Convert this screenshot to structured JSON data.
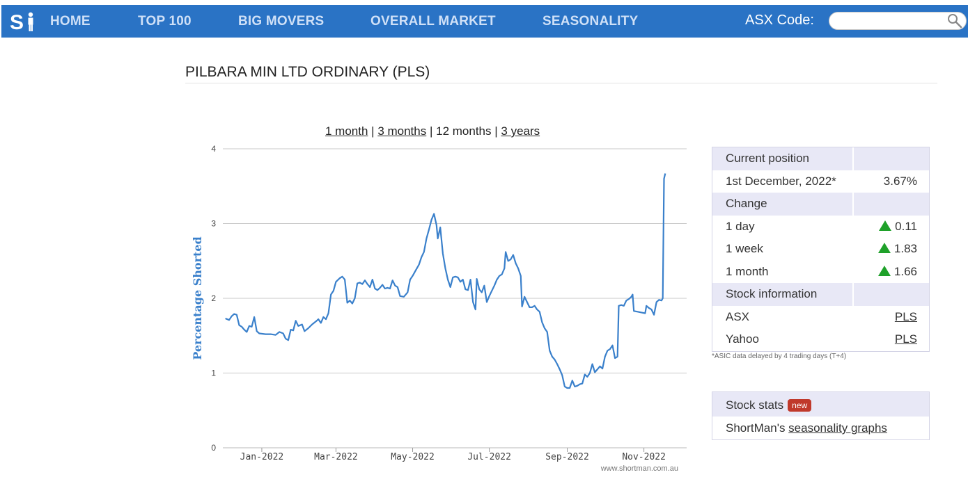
{
  "nav": {
    "items": [
      "HOME",
      "TOP 100",
      "BIG MOVERS",
      "OVERALL MARKET",
      "SEASONALITY"
    ],
    "asx_code_label": "ASX Code:",
    "search_value": ""
  },
  "page": {
    "title": "PILBARA MIN LTD ORDINARY (PLS)"
  },
  "range": {
    "links": [
      "1 month",
      "3 months",
      "12 months",
      "3 years"
    ],
    "active": "12 months"
  },
  "chart_data": {
    "type": "line",
    "ylabel": "Percentage Shorted",
    "ylim": [
      0,
      4
    ],
    "yticks": [
      "0",
      "1",
      "2",
      "3",
      "4"
    ],
    "xticks": [
      "Jan-2022",
      "Mar-2022",
      "May-2022",
      "Jul-2022",
      "Sep-2022",
      "Nov-2022"
    ],
    "xlim": [
      "2021-12-01",
      "2022-12-05"
    ],
    "grid": true,
    "watermark": "www.shortman.com.au",
    "line_color": "#3a80cb",
    "series": [
      {
        "points": [
          [
            "2021-12-03",
            1.73
          ],
          [
            "2021-12-06",
            1.71
          ],
          [
            "2021-12-08",
            1.76
          ],
          [
            "2021-12-10",
            1.79
          ],
          [
            "2021-12-12",
            1.78
          ],
          [
            "2021-12-14",
            1.64
          ],
          [
            "2021-12-16",
            1.62
          ],
          [
            "2021-12-18",
            1.58
          ],
          [
            "2021-12-20",
            1.55
          ],
          [
            "2021-12-22",
            1.63
          ],
          [
            "2021-12-24",
            1.62
          ],
          [
            "2021-12-26",
            1.75
          ],
          [
            "2021-12-28",
            1.56
          ],
          [
            "2021-12-30",
            1.53
          ],
          [
            "2022-01-04",
            1.52
          ],
          [
            "2022-01-08",
            1.52
          ],
          [
            "2022-01-12",
            1.51
          ],
          [
            "2022-01-15",
            1.55
          ],
          [
            "2022-01-18",
            1.53
          ],
          [
            "2022-01-20",
            1.46
          ],
          [
            "2022-01-22",
            1.44
          ],
          [
            "2022-01-24",
            1.58
          ],
          [
            "2022-01-26",
            1.57
          ],
          [
            "2022-01-28",
            1.7
          ],
          [
            "2022-01-30",
            1.63
          ],
          [
            "2022-02-02",
            1.65
          ],
          [
            "2022-02-04",
            1.56
          ],
          [
            "2022-02-07",
            1.6
          ],
          [
            "2022-02-10",
            1.65
          ],
          [
            "2022-02-13",
            1.69
          ],
          [
            "2022-02-15",
            1.72
          ],
          [
            "2022-02-17",
            1.67
          ],
          [
            "2022-02-19",
            1.75
          ],
          [
            "2022-02-21",
            1.72
          ],
          [
            "2022-02-23",
            1.8
          ],
          [
            "2022-02-25",
            2.05
          ],
          [
            "2022-02-27",
            2.1
          ],
          [
            "2022-03-01",
            2.22
          ],
          [
            "2022-03-04",
            2.27
          ],
          [
            "2022-03-06",
            2.29
          ],
          [
            "2022-03-08",
            2.25
          ],
          [
            "2022-03-10",
            1.94
          ],
          [
            "2022-03-12",
            1.97
          ],
          [
            "2022-03-14",
            1.93
          ],
          [
            "2022-03-16",
            2.0
          ],
          [
            "2022-03-18",
            2.2
          ],
          [
            "2022-03-20",
            2.21
          ],
          [
            "2022-03-22",
            2.19
          ],
          [
            "2022-03-24",
            2.24
          ],
          [
            "2022-03-26",
            2.19
          ],
          [
            "2022-03-28",
            2.15
          ],
          [
            "2022-03-30",
            2.25
          ],
          [
            "2022-04-01",
            2.13
          ],
          [
            "2022-04-03",
            2.11
          ],
          [
            "2022-04-05",
            2.14
          ],
          [
            "2022-04-07",
            2.18
          ],
          [
            "2022-04-09",
            2.13
          ],
          [
            "2022-04-11",
            2.14
          ],
          [
            "2022-04-13",
            2.13
          ],
          [
            "2022-04-15",
            2.24
          ],
          [
            "2022-04-17",
            2.17
          ],
          [
            "2022-04-19",
            2.15
          ],
          [
            "2022-04-21",
            2.03
          ],
          [
            "2022-04-24",
            2.02
          ],
          [
            "2022-04-27",
            2.08
          ],
          [
            "2022-04-29",
            2.25
          ],
          [
            "2022-05-01",
            2.3
          ],
          [
            "2022-05-03",
            2.36
          ],
          [
            "2022-05-06",
            2.45
          ],
          [
            "2022-05-08",
            2.55
          ],
          [
            "2022-05-10",
            2.62
          ],
          [
            "2022-05-12",
            2.8
          ],
          [
            "2022-05-14",
            2.92
          ],
          [
            "2022-05-16",
            3.05
          ],
          [
            "2022-05-18",
            3.13
          ],
          [
            "2022-05-20",
            2.98
          ],
          [
            "2022-05-21",
            2.8
          ],
          [
            "2022-05-23",
            2.95
          ],
          [
            "2022-05-25",
            2.6
          ],
          [
            "2022-05-27",
            2.4
          ],
          [
            "2022-05-29",
            2.25
          ],
          [
            "2022-05-31",
            2.15
          ],
          [
            "2022-06-02",
            2.28
          ],
          [
            "2022-06-04",
            2.29
          ],
          [
            "2022-06-06",
            2.28
          ],
          [
            "2022-06-08",
            2.22
          ],
          [
            "2022-06-10",
            2.25
          ],
          [
            "2022-06-12",
            2.12
          ],
          [
            "2022-06-14",
            2.11
          ],
          [
            "2022-06-16",
            2.25
          ],
          [
            "2022-06-18",
            1.95
          ],
          [
            "2022-06-20",
            1.85
          ],
          [
            "2022-06-21",
            2.26
          ],
          [
            "2022-06-23",
            2.12
          ],
          [
            "2022-06-25",
            2.08
          ],
          [
            "2022-06-27",
            2.17
          ],
          [
            "2022-06-29",
            1.95
          ],
          [
            "2022-07-01",
            2.03
          ],
          [
            "2022-07-03",
            2.1
          ],
          [
            "2022-07-05",
            2.17
          ],
          [
            "2022-07-07",
            2.25
          ],
          [
            "2022-07-09",
            2.3
          ],
          [
            "2022-07-11",
            2.32
          ],
          [
            "2022-07-13",
            2.4
          ],
          [
            "2022-07-14",
            2.62
          ],
          [
            "2022-07-16",
            2.5
          ],
          [
            "2022-07-18",
            2.52
          ],
          [
            "2022-07-20",
            2.58
          ],
          [
            "2022-07-22",
            2.47
          ],
          [
            "2022-07-24",
            2.4
          ],
          [
            "2022-07-26",
            2.3
          ],
          [
            "2022-07-27",
            1.89
          ],
          [
            "2022-07-29",
            2.02
          ],
          [
            "2022-07-31",
            1.95
          ],
          [
            "2022-08-02",
            1.88
          ],
          [
            "2022-08-04",
            1.88
          ],
          [
            "2022-08-06",
            1.9
          ],
          [
            "2022-08-08",
            1.85
          ],
          [
            "2022-08-10",
            1.82
          ],
          [
            "2022-08-12",
            1.68
          ],
          [
            "2022-08-14",
            1.6
          ],
          [
            "2022-08-16",
            1.55
          ],
          [
            "2022-08-18",
            1.3
          ],
          [
            "2022-08-20",
            1.22
          ],
          [
            "2022-08-22",
            1.18
          ],
          [
            "2022-08-24",
            1.12
          ],
          [
            "2022-08-26",
            1.05
          ],
          [
            "2022-08-28",
            0.97
          ],
          [
            "2022-08-30",
            0.82
          ],
          [
            "2022-09-01",
            0.8
          ],
          [
            "2022-09-03",
            0.8
          ],
          [
            "2022-09-05",
            0.9
          ],
          [
            "2022-09-07",
            0.82
          ],
          [
            "2022-09-09",
            0.83
          ],
          [
            "2022-09-11",
            0.85
          ],
          [
            "2022-09-13",
            0.86
          ],
          [
            "2022-09-15",
            0.98
          ],
          [
            "2022-09-17",
            0.95
          ],
          [
            "2022-09-19",
            1.0
          ],
          [
            "2022-09-21",
            1.12
          ],
          [
            "2022-09-23",
            1.01
          ],
          [
            "2022-09-25",
            1.05
          ],
          [
            "2022-09-27",
            1.09
          ],
          [
            "2022-09-29",
            1.06
          ],
          [
            "2022-10-01",
            1.22
          ],
          [
            "2022-10-03",
            1.3
          ],
          [
            "2022-10-05",
            1.32
          ],
          [
            "2022-10-07",
            1.37
          ],
          [
            "2022-10-09",
            1.2
          ],
          [
            "2022-10-11",
            1.22
          ],
          [
            "2022-10-12",
            1.9
          ],
          [
            "2022-10-14",
            1.91
          ],
          [
            "2022-10-16",
            1.9
          ],
          [
            "2022-10-18",
            1.97
          ],
          [
            "2022-10-20",
            1.99
          ],
          [
            "2022-10-22",
            2.02
          ],
          [
            "2022-10-23",
            2.05
          ],
          [
            "2022-10-24",
            1.83
          ],
          [
            "2022-10-27",
            1.82
          ],
          [
            "2022-10-30",
            1.81
          ],
          [
            "2022-11-02",
            1.8
          ],
          [
            "2022-11-03",
            1.9
          ],
          [
            "2022-11-05",
            1.87
          ],
          [
            "2022-11-07",
            1.85
          ],
          [
            "2022-11-09",
            1.78
          ],
          [
            "2022-11-11",
            1.95
          ],
          [
            "2022-11-13",
            1.98
          ],
          [
            "2022-11-15",
            1.97
          ],
          [
            "2022-11-16",
            2.0
          ],
          [
            "2022-11-17",
            3.6
          ],
          [
            "2022-11-18",
            3.67
          ]
        ]
      }
    ]
  },
  "info_table": {
    "rows": [
      {
        "type": "head",
        "c1": "Current position",
        "c2": ""
      },
      {
        "type": "plain",
        "c1": "1st December, 2022*",
        "c2": "3.67%"
      },
      {
        "type": "head",
        "c1": "Change",
        "c2": ""
      },
      {
        "type": "up",
        "c1": "1 day",
        "c2": "0.11"
      },
      {
        "type": "up",
        "c1": "1 week",
        "c2": "1.83"
      },
      {
        "type": "up",
        "c1": "1 month",
        "c2": "1.66"
      },
      {
        "type": "head",
        "c1": "Stock information",
        "c2": ""
      },
      {
        "type": "link",
        "c1": "ASX",
        "c2": "PLS"
      },
      {
        "type": "link",
        "c1": "Yahoo",
        "c2": "PLS"
      }
    ],
    "footnote": "*ASIC data delayed by 4 trading days (T+4)",
    "up_color": "#1fa12a"
  },
  "stats": {
    "title": "Stock stats",
    "badge": "new",
    "body_prefix": "ShortMan's ",
    "body_link": "seasonality graphs"
  }
}
